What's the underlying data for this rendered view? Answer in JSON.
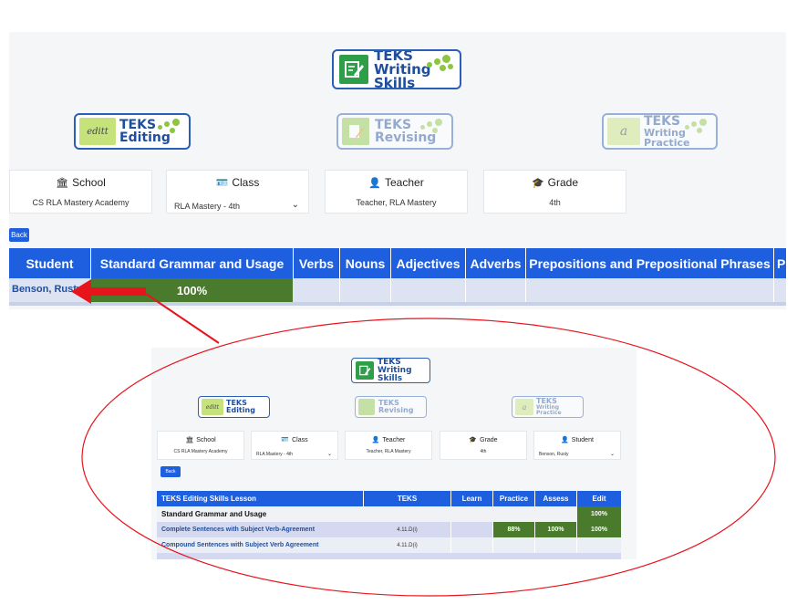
{
  "logos": {
    "writing_skills": {
      "line1": "TEKS",
      "line2": "Writing Skills"
    },
    "editing": {
      "icon_text": "editt",
      "line1": "TEKS",
      "line2": "Editing"
    },
    "revising": {
      "line1": "TEKS",
      "line2": "Revising"
    },
    "writing_practice": {
      "icon_text": "a",
      "line1": "TEKS",
      "line2": "Writing Practice"
    }
  },
  "filters": {
    "school": {
      "label": "School",
      "value": "CS RLA Mastery Academy"
    },
    "class": {
      "label": "Class",
      "value": "RLA Mastery - 4th"
    },
    "teacher": {
      "label": "Teacher",
      "value": "Teacher, RLA Mastery"
    },
    "grade": {
      "label": "Grade",
      "value": "4th"
    }
  },
  "back_label": "Back",
  "table": {
    "headers": [
      "Student",
      "Standard Grammar and Usage",
      "Verbs",
      "Nouns",
      "Adjectives",
      "Adverbs",
      "Prepositions and Prepositional Phrases",
      "Pr"
    ],
    "row": {
      "student": "Benson, Rusty",
      "grammar_score": "100%"
    }
  },
  "inset": {
    "filters": {
      "school": {
        "label": "School",
        "value": "CS RLA Mastery Academy"
      },
      "class": {
        "label": "Class",
        "value": "RLA Mastery - 4th"
      },
      "teacher": {
        "label": "Teacher",
        "value": "Teacher, RLA Mastery"
      },
      "grade": {
        "label": "Grade",
        "value": "4th"
      },
      "student": {
        "label": "Student",
        "value": "Benson, Rusty"
      }
    },
    "back_label": "Back",
    "headers": [
      "TEKS Editing Skills Lesson",
      "TEKS",
      "Learn",
      "Practice",
      "Assess",
      "Edit"
    ],
    "section": {
      "title": "Standard Grammar and Usage",
      "edit": "100%"
    },
    "rows": [
      {
        "lesson": "Complete Sentences with Subject Verb-Agreement",
        "teks": "4.11.D(i)",
        "learn": "",
        "practice": "88%",
        "assess": "100%",
        "edit": "100%"
      },
      {
        "lesson": "Compound Sentences with Subject Verb Agreement",
        "teks": "4.11.D(i)",
        "learn": "",
        "practice": "",
        "assess": "",
        "edit": ""
      }
    ]
  },
  "colors": {
    "brand_blue": "#1e5fe0",
    "success_green": "#4a7a2b",
    "logo_green": "#8cc63f",
    "annotation_red": "#e8141c"
  }
}
